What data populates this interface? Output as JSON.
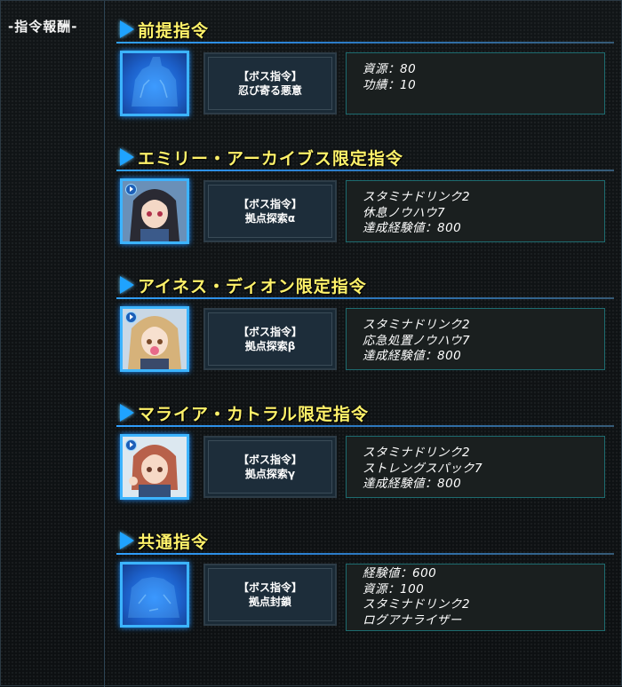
{
  "header_label": "-指令報酬-",
  "sections": [
    {
      "title": "前提指令",
      "portrait": "silhouette",
      "mission_type": "【ボス指令】",
      "mission_name": "忍び寄る悪意",
      "rewards": [
        "資源：80",
        "功績：10"
      ]
    },
    {
      "title": "エミリー・アーカイブス限定指令",
      "portrait": "character-black-hair",
      "mission_type": "【ボス指令】",
      "mission_name": "拠点探索α",
      "rewards": [
        "スタミナドリンク2",
        "休息ノウハウ7",
        "達成経験値：800"
      ]
    },
    {
      "title": "アイネス・ディオン限定指令",
      "portrait": "character-blonde-hair",
      "mission_type": "【ボス指令】",
      "mission_name": "拠点探索β",
      "rewards": [
        "スタミナドリンク2",
        "応急処置ノウハウ7",
        "達成経験値：800"
      ]
    },
    {
      "title": "マライア・カトラル限定指令",
      "portrait": "character-red-hair",
      "mission_type": "【ボス指令】",
      "mission_name": "拠点探索γ",
      "rewards": [
        "スタミナドリンク2",
        "ストレングスパック7",
        "達成経験値：800"
      ]
    },
    {
      "title": "共通指令",
      "portrait": "silhouette",
      "mission_type": "【ボス指令】",
      "mission_name": "拠点封鎖",
      "rewards": [
        "経験値：600",
        "資源：100",
        "スタミナドリンク2",
        "ログアナライザー"
      ]
    }
  ],
  "colors": {
    "title_yellow": "#fff26a",
    "accent_blue": "#1fa3ff",
    "reward_border": "#1d6b6f"
  }
}
